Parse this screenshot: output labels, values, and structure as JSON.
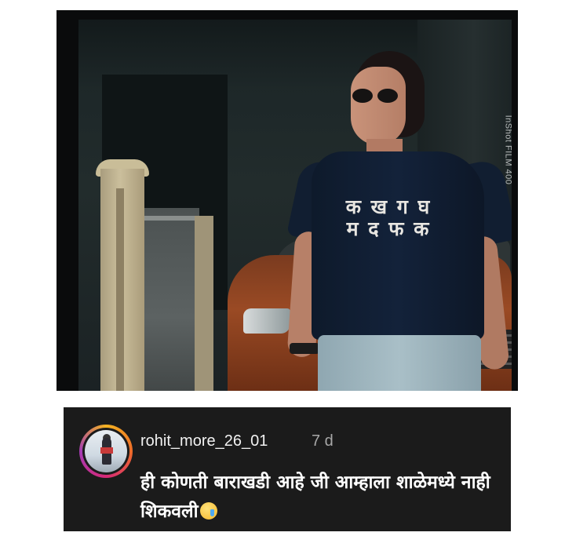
{
  "post": {
    "photo_description_icon": "photo-image",
    "shirt_text_line1": "क ख ग घ",
    "shirt_text_line2": "म द फ क",
    "watermark": "InShot FILM 400"
  },
  "comment": {
    "username": "rohit_more_26_01",
    "time": "7 d",
    "text": "ही कोणती बाराखडी आहे जी आम्हाला शाळेमध्ये नाही शिकवली",
    "emoji": "crying-face"
  },
  "colors": {
    "card_background": "#1b1b1b",
    "username": "#f2f2f2",
    "time": "#a8a8a8"
  }
}
